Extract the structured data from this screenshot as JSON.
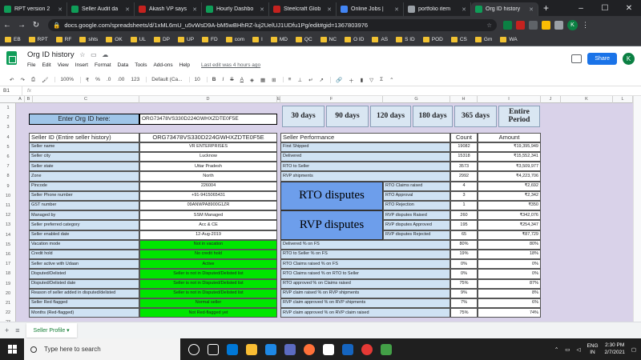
{
  "browser": {
    "tabs": [
      {
        "title": "RPT version 2",
        "color": "#0f9d58",
        "active": false
      },
      {
        "title": "Seller Audit da",
        "color": "#0f9d58",
        "active": false
      },
      {
        "title": "Akash VP says",
        "color": "#c5221f",
        "active": false
      },
      {
        "title": "Hourly Dashbo",
        "color": "#0f9d58",
        "active": false
      },
      {
        "title": "Steelcraft Glob",
        "color": "#c5221f",
        "active": false
      },
      {
        "title": "Online Jobs |",
        "color": "#4285f4",
        "active": false
      },
      {
        "title": "portfolio item",
        "color": "#9aa0a6",
        "active": false
      },
      {
        "title": "Org ID history",
        "color": "#0f9d58",
        "active": true
      }
    ],
    "url": "docs.google.com/spreadsheets/d/1xML6mU_u5vWsD9A-bM5wBHhRZ-luj2UelUJ1UDfu1Pg/edit#gid=1367803976",
    "profile_initial": "K",
    "bookmarks": [
      "EB",
      "RPT",
      "RF",
      "shts",
      "OK",
      "UL",
      "DP",
      "UP",
      "FD",
      "com",
      "I",
      "MD",
      "QC",
      "NC",
      "O ID",
      "AS",
      "S ID",
      "POD",
      "CS",
      "Gm",
      "WA"
    ]
  },
  "sheets": {
    "doc_title": "Org ID history",
    "menus": [
      "File",
      "Edit",
      "View",
      "Insert",
      "Format",
      "Data",
      "Tools",
      "Add-ons",
      "Help"
    ],
    "last_edit": "Last edit was 4 hours ago",
    "share_label": "Share",
    "profile_initial": "K",
    "toolbar": {
      "zoom": "100%",
      "currency": "₹",
      "percent": "%",
      "decimals1": ".0",
      "decimals2": ".00",
      "format123": "123",
      "font": "Default (Ca...",
      "size": "10",
      "bold": "B",
      "italic": "I",
      "strike": "S",
      "textcolor": "A"
    },
    "name_box": "B1",
    "formula_icon": "fx",
    "columns": [
      "A",
      "B",
      "C",
      "D",
      "E",
      "F",
      "G",
      "H",
      "I",
      "J",
      "K",
      "L"
    ],
    "rows": [
      "1",
      "2",
      "3",
      "4",
      "5",
      "6",
      "7",
      "8",
      "9",
      "10",
      "11",
      "12",
      "13",
      "14",
      "15",
      "16",
      "17",
      "18",
      "19",
      "20",
      "21",
      "22",
      "23"
    ],
    "sheet_tab": "Seller Profile"
  },
  "profile": {
    "enter_label": "Enter Org ID here:",
    "org_input": "ORG73478VS330D224GWHXZDTE0F5E",
    "section_title": "Seller ID (Entire seller history)",
    "section_value": "ORG73478VS330D224GWHXZDTE0F5E",
    "fields": [
      {
        "label": "Seller name",
        "value": "VR ENTERPRISES",
        "green": false
      },
      {
        "label": "Seller city",
        "value": "Lucknow",
        "green": false
      },
      {
        "label": "Seller state",
        "value": "Uttar Pradesh",
        "green": false
      },
      {
        "label": "Zone",
        "value": "North",
        "green": false
      },
      {
        "label": "Pincode",
        "value": "226004",
        "green": false
      },
      {
        "label": "Seller Phone number",
        "value": "+91-9415065431",
        "green": false
      },
      {
        "label": "GST number",
        "value": "09ANWPA8900G1ZR",
        "green": false
      },
      {
        "label": "Managed by",
        "value": "SSM Managed",
        "green": false
      },
      {
        "label": "Seller preferred category",
        "value": "Acc & CE",
        "green": false
      },
      {
        "label": "Seller enabled date",
        "value": "12-Aug-2019",
        "green": false
      },
      {
        "label": "Vacation mode",
        "value": "Not in vacation",
        "green": true
      },
      {
        "label": "Credit hold",
        "value": "No credit hold",
        "green": true
      },
      {
        "label": "Seller active with Udaan",
        "value": "Active",
        "green": true
      },
      {
        "label": "Disputed/Delisted",
        "value": "Seller is not in Disputed/Delisted list",
        "green": true
      },
      {
        "label": "Disputed/Delisted date",
        "value": "Seller is not in Disputed/Delisted list",
        "green": true
      },
      {
        "label": "Reason of seller added in disputed/delisted",
        "value": "Seller is not in Disputed/Delisted list",
        "green": true
      },
      {
        "label": "Seller Red flagged",
        "value": "Normal seller",
        "green": true
      },
      {
        "label": "Months (Red-flagged)",
        "value": "Not Red-flagged yet",
        "green": true
      }
    ]
  },
  "periods": [
    "30 days",
    "90 days",
    "120 days",
    "180 days",
    "365 days",
    "Entire Period"
  ],
  "performance": {
    "title": "Seller Performance",
    "count_header": "Count",
    "amount_header": "Amount",
    "rows": [
      {
        "label": "First Shipped",
        "count": "19082",
        "amount": "₹19,395,949"
      },
      {
        "label": "Delivered",
        "count": "15318",
        "amount": "₹15,552,341"
      },
      {
        "label": "RTO to Seller",
        "count": "3573",
        "amount": "₹3,509,977"
      },
      {
        "label": "RVP shipments",
        "count": "2992",
        "amount": "₹4,223,706"
      }
    ],
    "rto_title": "RTO disputes",
    "rto_rows": [
      {
        "label": "RTO Claims raised",
        "count": "4",
        "amount": "₹2,692"
      },
      {
        "label": "RTO Approval",
        "count": "3",
        "amount": "₹2,342"
      },
      {
        "label": "RTO Rejection",
        "count": "1",
        "amount": "₹350"
      }
    ],
    "rvp_title": "RVP disputes",
    "rvp_rows": [
      {
        "label": "RVP disputes Raised",
        "count": "260",
        "amount": "₹342,076"
      },
      {
        "label": "RVP disputes Approved",
        "count": "195",
        "amount": "₹254,347"
      },
      {
        "label": "RVP disputes Rejected",
        "count": "65",
        "amount": "₹87,729"
      }
    ],
    "pct_rows": [
      {
        "label": "Delivered % on FS",
        "count": "80%",
        "amount": "80%"
      },
      {
        "label": "RTO to Seller % on FS",
        "count": "19%",
        "amount": "18%"
      },
      {
        "label": "RTO Claims raised % on FS",
        "count": "0%",
        "amount": "0%"
      },
      {
        "label": "RTO Claims raised % on RTO to Seller",
        "count": "0%",
        "amount": "0%"
      },
      {
        "label": "RTO approved % on Claims raised",
        "count": "75%",
        "amount": "87%"
      },
      {
        "label": "RVP claim raised % on RVP shipments",
        "count": "9%",
        "amount": "8%"
      },
      {
        "label": "RVP claim approved % on RVP shipments",
        "count": "7%",
        "amount": "6%"
      },
      {
        "label": "RVP claim approved % on RVP claim raised",
        "count": "75%",
        "amount": "74%"
      }
    ]
  },
  "taskbar": {
    "search_placeholder": "Type here to search",
    "lang": "ENG",
    "region": "IN",
    "time": "2:30 PM",
    "date": "2/7/2021"
  }
}
